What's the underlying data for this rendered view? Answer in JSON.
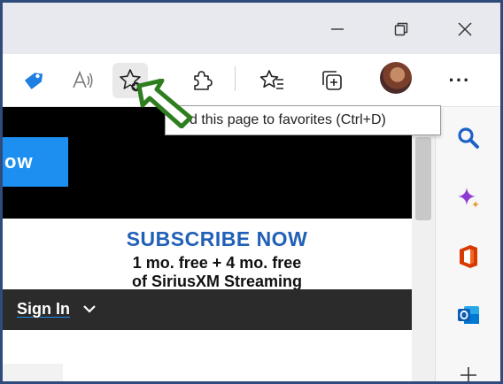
{
  "window": {
    "minimize_icon": "minimize-icon",
    "restore_icon": "restore-icon",
    "close_icon": "close-icon"
  },
  "toolbar": {
    "icons": [
      "tag-icon",
      "read-aloud-icon",
      "add-favorite-icon",
      "extensions-icon",
      "favorites-icon",
      "collections-icon",
      "profile-avatar",
      "more-icon"
    ],
    "more_label": "···"
  },
  "tooltip": {
    "text": "d this page to favorites (Ctrl+D)"
  },
  "page": {
    "hero_button_text": "ow",
    "promo_title": "SUBSCRIBE NOW",
    "promo_line1": "1 mo. free + 4 mo. free",
    "promo_line2": "of SiriusXM Streaming",
    "signin_label": "Sign In"
  },
  "sidebar": {
    "icons": [
      "search-icon",
      "copilot-icon",
      "office-icon",
      "outlook-icon",
      "add-icon"
    ]
  },
  "colors": {
    "frame": "#2f4b7c",
    "accent_blue": "#1d8ff0",
    "promo_blue": "#2160b8",
    "arrow_green": "#2e7d1f"
  }
}
